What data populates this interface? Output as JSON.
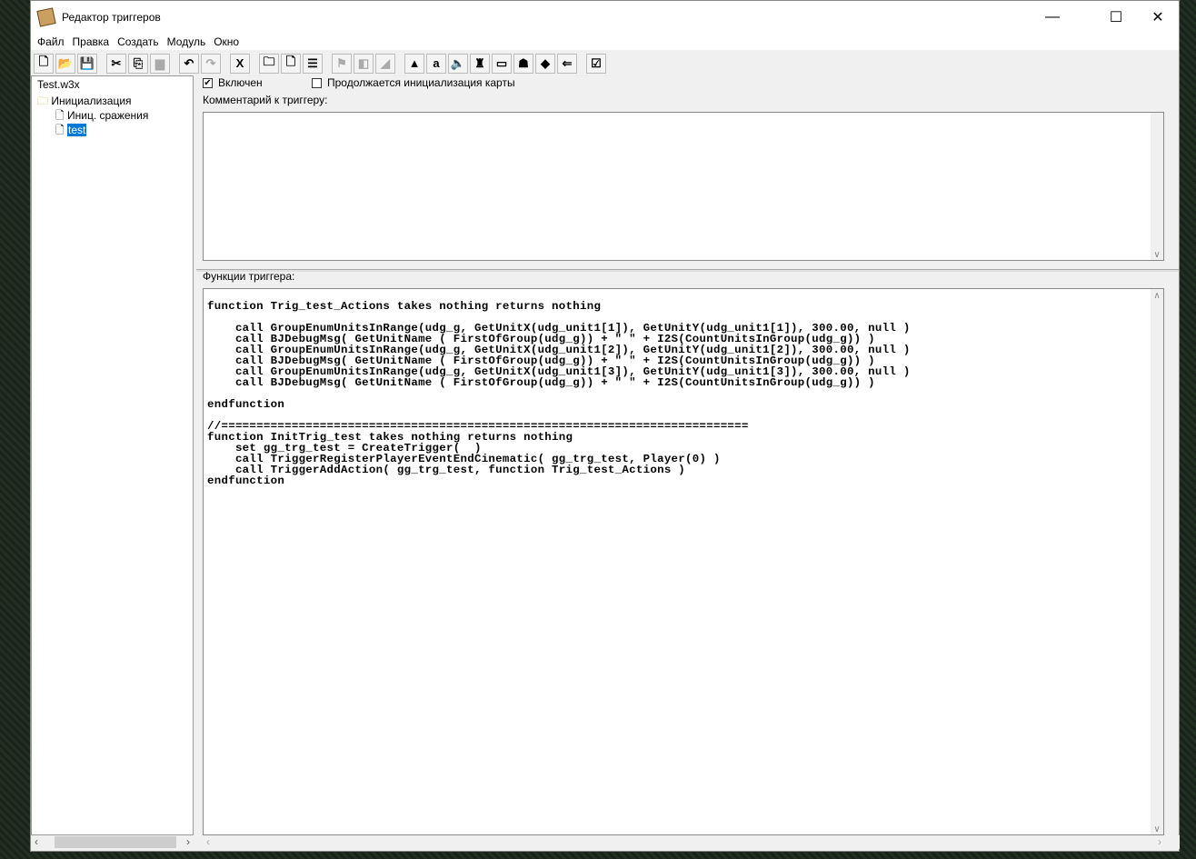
{
  "window": {
    "title": "Редактор триггеров",
    "min": "—",
    "max": "☐",
    "close": "✕"
  },
  "menu": [
    "Файл",
    "Правка",
    "Создать",
    "Модуль",
    "Окно"
  ],
  "toolbar": [
    {
      "name": "new",
      "glyph": "🗋",
      "disabled": false
    },
    {
      "name": "open",
      "glyph": "📂",
      "disabled": false
    },
    {
      "name": "save",
      "glyph": "💾",
      "disabled": false
    },
    {
      "sep": true
    },
    {
      "name": "cut",
      "glyph": "✂",
      "disabled": false
    },
    {
      "name": "copy",
      "glyph": "⎘",
      "disabled": false
    },
    {
      "name": "paste",
      "glyph": "▆",
      "disabled": true
    },
    {
      "sep": true
    },
    {
      "name": "undo",
      "glyph": "↶",
      "disabled": false
    },
    {
      "name": "redo",
      "glyph": "↷",
      "disabled": true
    },
    {
      "sep": true
    },
    {
      "name": "trigger-editor",
      "glyph": "X",
      "disabled": false
    },
    {
      "sep": true
    },
    {
      "name": "new-category",
      "glyph": "🗀",
      "disabled": false
    },
    {
      "name": "new-trigger",
      "glyph": "🗋",
      "disabled": false
    },
    {
      "name": "new-comment",
      "glyph": "☰",
      "disabled": false
    },
    {
      "sep": true
    },
    {
      "name": "new-event",
      "glyph": "⚑",
      "disabled": true
    },
    {
      "name": "new-condition",
      "glyph": "◧",
      "disabled": true
    },
    {
      "name": "new-action",
      "glyph": "◢",
      "disabled": true
    },
    {
      "sep": true
    },
    {
      "name": "terrain-editor",
      "glyph": "▲",
      "disabled": false
    },
    {
      "name": "text-editor",
      "glyph": "a",
      "disabled": false
    },
    {
      "name": "sound-editor",
      "glyph": "🔈",
      "disabled": false
    },
    {
      "name": "object-editor",
      "glyph": "♜",
      "disabled": false
    },
    {
      "name": "campaign-editor",
      "glyph": "▭",
      "disabled": false
    },
    {
      "name": "ai-editor",
      "glyph": "☗",
      "disabled": false
    },
    {
      "name": "object-manager",
      "glyph": "◆",
      "disabled": false
    },
    {
      "name": "import-manager",
      "glyph": "⇐",
      "disabled": false
    },
    {
      "sep": true
    },
    {
      "name": "test-map",
      "glyph": "☑",
      "disabled": false
    }
  ],
  "tree": {
    "root": "Test.w3x",
    "category": "Инициализация",
    "items": [
      "Иниц. сражения",
      "test"
    ],
    "selected": "test"
  },
  "trigger": {
    "enabled_label": "Включен",
    "enabled": true,
    "init_label": "Продолжается инициализация карты",
    "init": false,
    "comment_label": "Комментарий к триггеру:",
    "comment": "",
    "functions_label": "Функции триггера:",
    "code": "function Trig_test_Actions takes nothing returns nothing\n\n    call GroupEnumUnitsInRange(udg_g, GetUnitX(udg_unit1[1]), GetUnitY(udg_unit1[1]), 300.00, null )\n    call BJDebugMsg( GetUnitName ( FirstOfGroup(udg_g)) + \" \" + I2S(CountUnitsInGroup(udg_g)) )\n    call GroupEnumUnitsInRange(udg_g, GetUnitX(udg_unit1[2]), GetUnitY(udg_unit1[2]), 300.00, null )\n    call BJDebugMsg( GetUnitName ( FirstOfGroup(udg_g)) + \" \" + I2S(CountUnitsInGroup(udg_g)) )\n    call GroupEnumUnitsInRange(udg_g, GetUnitX(udg_unit1[3]), GetUnitY(udg_unit1[3]), 300.00, null )\n    call BJDebugMsg( GetUnitName ( FirstOfGroup(udg_g)) + \" \" + I2S(CountUnitsInGroup(udg_g)) )\n\nendfunction\n\n//===========================================================================\nfunction InitTrig_test takes nothing returns nothing\n    set gg_trg_test = CreateTrigger(  )\n    call TriggerRegisterPlayerEventEndCinematic( gg_trg_test, Player(0) )\n    call TriggerAddAction( gg_trg_test, function Trig_test_Actions )\nendfunction"
  }
}
